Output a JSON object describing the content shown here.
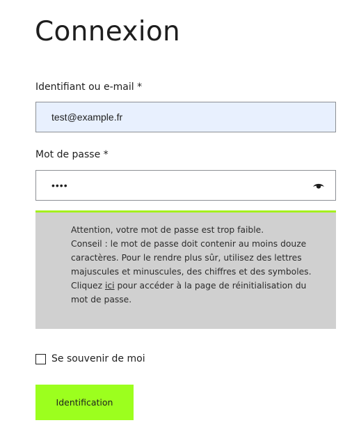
{
  "page": {
    "title": "Connexion"
  },
  "form": {
    "username_label": "Identifiant ou e-mail *",
    "username_value": "test@example.fr",
    "password_label": "Mot de passe *",
    "password_value": "••••",
    "password_toggle_icon": "eye-icon",
    "remember_label": "Se souvenir de moi",
    "remember_checked": false,
    "submit_label": "Identification"
  },
  "notice": {
    "line1": "Attention, votre mot de passe est trop faible.",
    "tip": "Conseil : le mot de passe doit contenir au moins douze caractères. Pour le rendre plus sûr, utilisez des lettres majuscules et minuscules, des chiffres et des symboles.",
    "reset_prefix": "Cliquez ",
    "reset_link": "ici",
    "reset_suffix": " pour accéder à la page de réinitialisation du mot de passe.",
    "accent_color": "#a5f01e"
  },
  "colors": {
    "button_background": "#9cff1e",
    "username_background": "#e8f0fe",
    "notice_background": "#d0d0d0"
  }
}
